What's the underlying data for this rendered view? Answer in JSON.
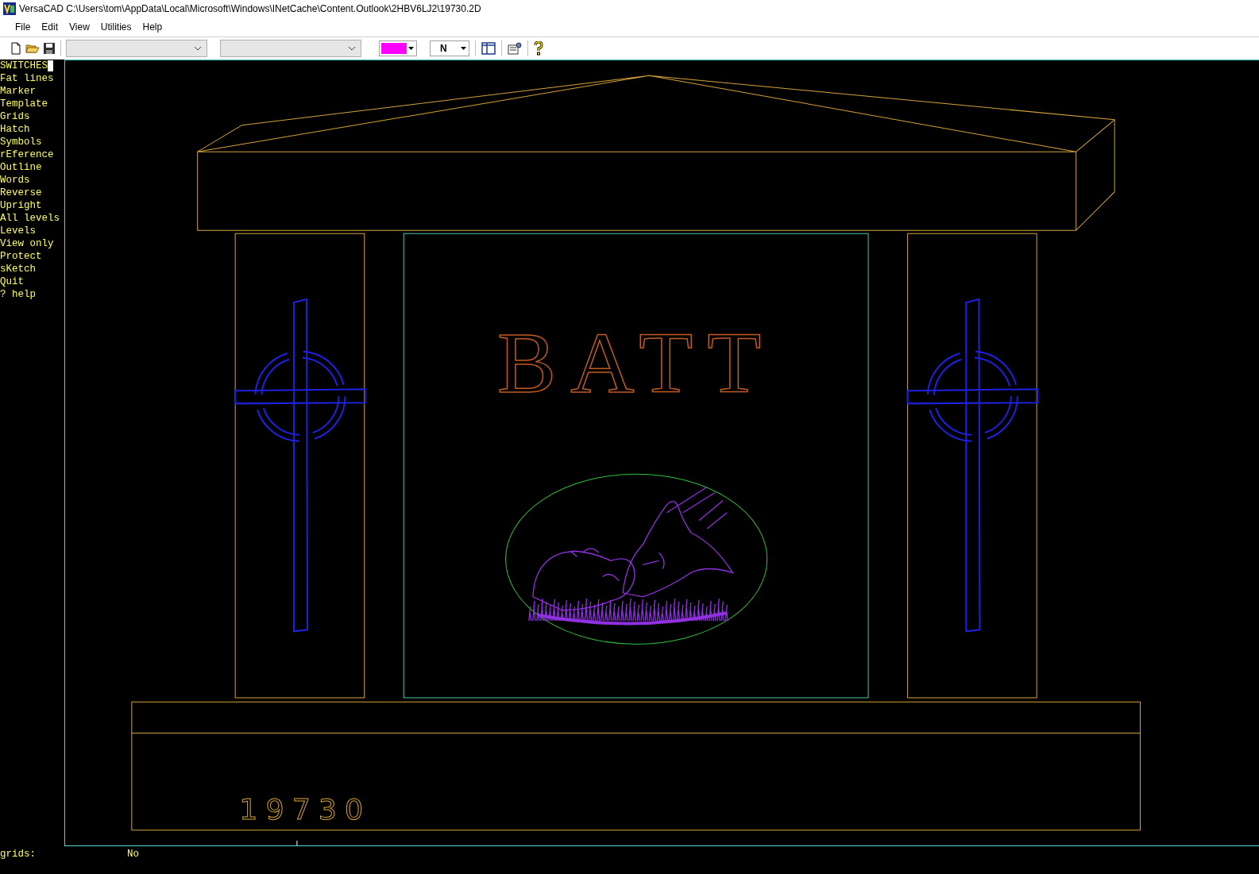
{
  "window": {
    "title": "VersaCAD  C:\\Users\\tom\\AppData\\Local\\Microsoft\\Windows\\INetCache\\Content.Outlook\\2HBV6LJ2\\19730.2D"
  },
  "menu": [
    "File",
    "Edit",
    "View",
    "Utilities",
    "Help"
  ],
  "toolbar": {
    "line_type": "N"
  },
  "side_menu": {
    "title": "SWITCHES",
    "cursor": true,
    "items": [
      "Fat lines",
      "Marker",
      "Template",
      "Grids",
      "Hatch",
      "Symbols",
      "rEference",
      "Outline",
      "Words",
      "Reverse",
      "Upright",
      "All levels",
      "Levels",
      "View only",
      "Protect",
      "sKetch",
      "Quit",
      "? help"
    ]
  },
  "drawing": {
    "name_text": "BATT",
    "number_text": "19730"
  },
  "status": {
    "prompt": "grids:",
    "value": "No"
  }
}
